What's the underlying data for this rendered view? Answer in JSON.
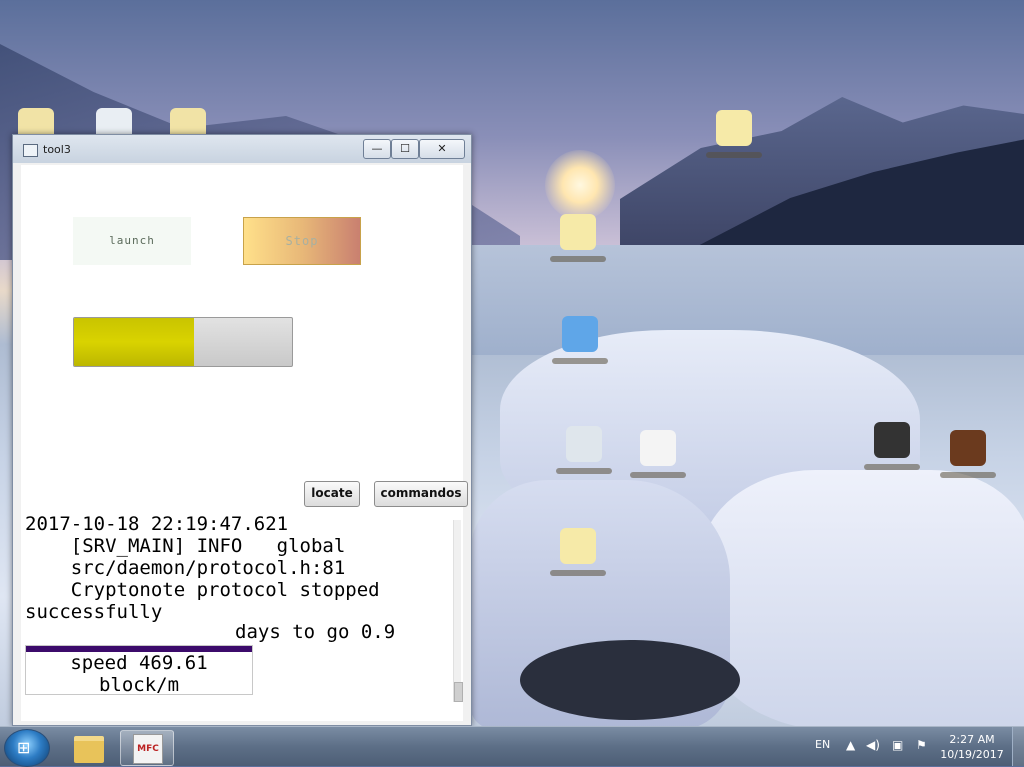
{
  "window": {
    "title": "tool3",
    "min_glyph": "—",
    "max_glyph": "☐",
    "close_glyph": "✕"
  },
  "controls": {
    "launch_label": "launch",
    "stop_label": "Stop",
    "progress_fraction": 0.55,
    "locate_label": "locate",
    "commandos_label": "commandos"
  },
  "log": {
    "lines": "2017-10-18 22:19:47.621\n    [SRV_MAIN] INFO   global\n    src/daemon/protocol.h:81\n    Cryptonote protocol stopped\nsuccessfully",
    "days_to_go": "days to go 0.9",
    "speed_line1": "speed 469.61",
    "speed_line2": "block/m"
  },
  "taskbar": {
    "start_glyph": "⊞",
    "app_icon_text": "MFC",
    "language": "EN",
    "time": "2:27 AM",
    "date": "10/19/2017"
  },
  "colors": {
    "progress_fill": "#d9d300",
    "speed_bar": "#3c0b6b"
  }
}
